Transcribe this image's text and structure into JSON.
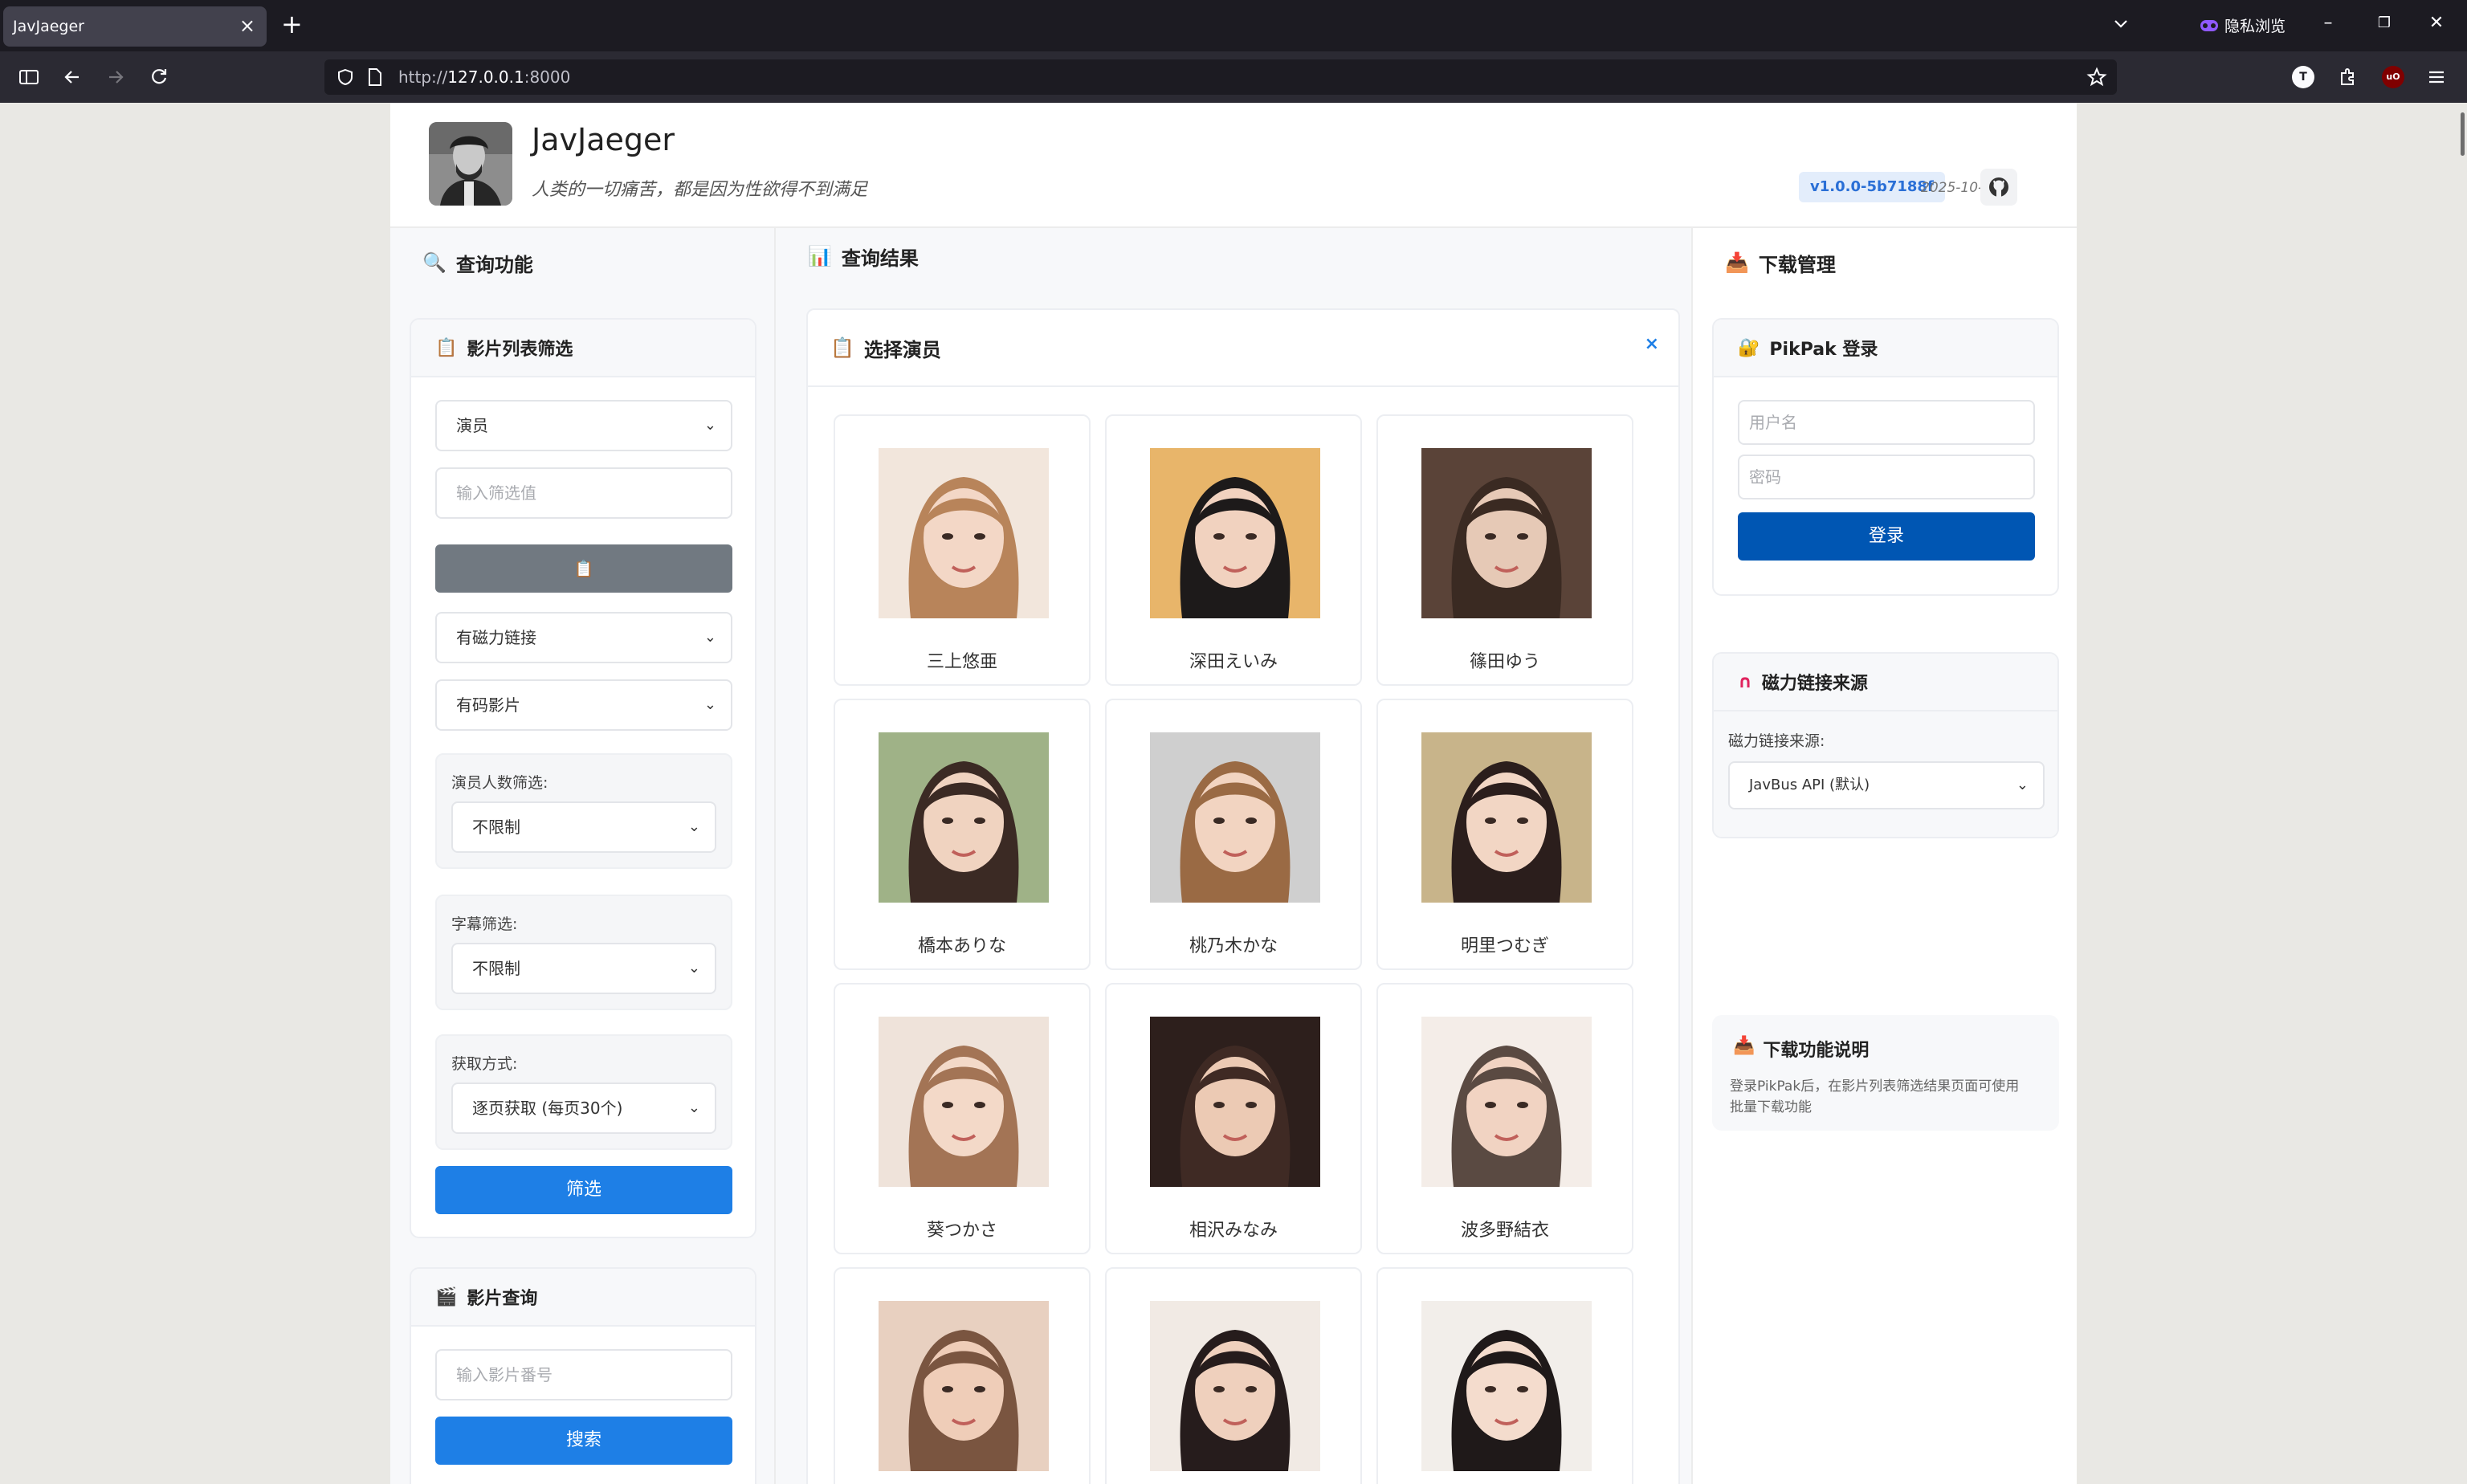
{
  "browser": {
    "tab_title": "JavJaeger",
    "private_label": "隐私浏览",
    "url_host": "127.0.0.1",
    "url_prefix": "http://",
    "url_suffix": ":8000"
  },
  "header": {
    "title": "JavJaeger",
    "subtitle": "人类的一切痛苦，都是因为性欲得不到满足",
    "version": "v1.0.0-5b7188f",
    "date": "2025-10-01"
  },
  "left": {
    "section_title": "查询功能",
    "filter_card": {
      "title": "影片列表筛选",
      "type_select": "演员",
      "value_placeholder": "输入筛选值",
      "button_icon": "📋",
      "magnet_select": "有磁力链接",
      "censor_select": "有码影片",
      "actor_count_label": "演员人数筛选:",
      "actor_count_select": "不限制",
      "subtitle_label": "字幕筛选:",
      "subtitle_select": "不限制",
      "fetch_label": "获取方式:",
      "fetch_select": "逐页获取 (每页30个)",
      "filter_button": "筛选"
    },
    "search_card": {
      "title": "影片查询",
      "placeholder": "输入影片番号",
      "search_button": "搜索"
    }
  },
  "middle": {
    "section_title": "查询结果",
    "panel_title": "选择演员",
    "close": "×",
    "actors": [
      {
        "name": "三上悠亜"
      },
      {
        "name": "深田えいみ"
      },
      {
        "name": "篠田ゆう"
      },
      {
        "name": "橋本ありな"
      },
      {
        "name": "桃乃木かな"
      },
      {
        "name": "明里つむぎ"
      },
      {
        "name": "葵つかさ"
      },
      {
        "name": "相沢みなみ"
      },
      {
        "name": "波多野結衣"
      },
      {
        "name": ""
      },
      {
        "name": ""
      },
      {
        "name": ""
      }
    ]
  },
  "right": {
    "section_title": "下载管理",
    "login_card": {
      "title": "PikPak 登录",
      "username_placeholder": "用户名",
      "password_placeholder": "密码",
      "login_button": "登录"
    },
    "magnet_card": {
      "title": "磁力链接来源",
      "label": "磁力链接来源:",
      "select": "JavBus API (默认)"
    },
    "info_card": {
      "title": "下载功能说明",
      "text_line1": "登录PikPak后，在影片列表筛选结果页面可使用",
      "text_line2": "批量下载功能"
    }
  }
}
